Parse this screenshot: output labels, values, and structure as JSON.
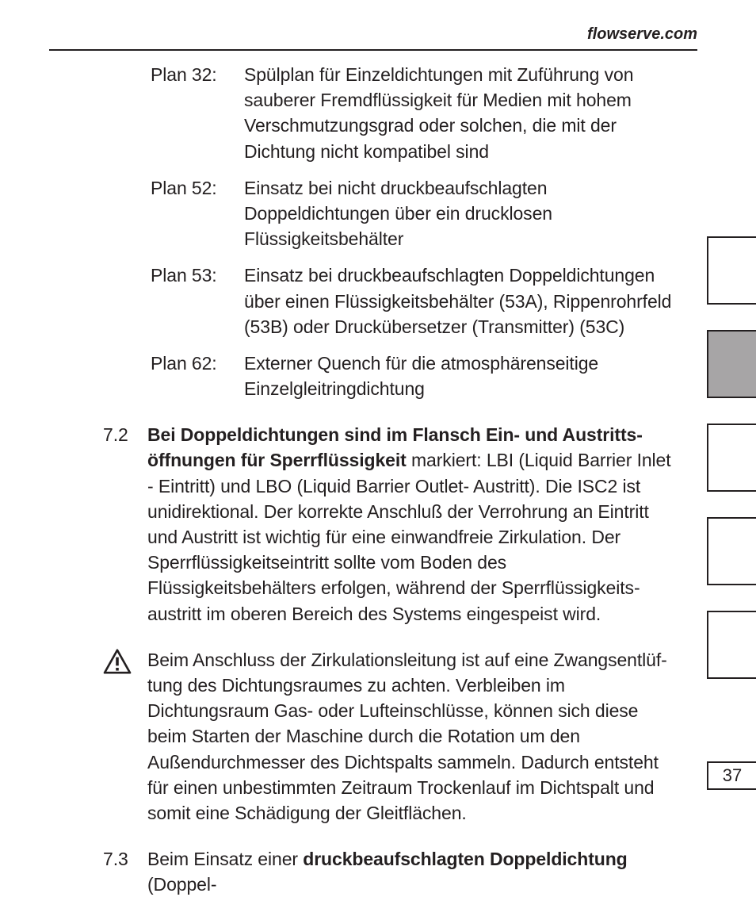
{
  "header": {
    "site": "flowserve.com"
  },
  "plans": [
    {
      "label": "Plan 32:",
      "text": "Spülplan für Einzeldichtungen mit Zuführung von sauberer Fremdflüssigkeit für Medien mit hohem Verschmutzungsgrad oder solchen, die mit der Dichtung nicht kompatibel sind"
    },
    {
      "label": "Plan 52:",
      "text": "Einsatz bei nicht druckbeaufschlagten Doppeldichtungen über ein drucklosen Flüssigkeitsbehälter"
    },
    {
      "label": "Plan 53:",
      "text": "Einsatz bei druckbeaufschlagten Doppeldichtungen über einen Flüssigkeitsbehälter (53A), Rippenrohrfeld (53B) oder Druckübersetzer (Transmitter) (53C)"
    },
    {
      "label": "Plan 62:",
      "text": "Externer Quench für die atmosphärenseitige Einzelgleitringdichtung"
    }
  ],
  "sections": {
    "s72_num": "7.2",
    "s72_bold": "Bei Doppeldichtungen sind im Flansch Ein- und Austritts­öffnungen für Sperrflüssigkeit",
    "s72_rest": " markiert: LBI (Liquid Barrier Inlet - Eintritt) und LBO (Liquid Barrier Outlet- Austritt). Die ISC2 ist unidirektional. Der korrekte Anschluß der Verrohrung an Eintritt und Austritt ist wichtig für eine einwandfreie Zirkulation. Der Sperrflüssigkeitseintritt sollte vom Boden des Flüssigkeitsbehälters erfolgen, während der Sperrflüssigkeits­austritt im oberen Bereich des Systems eingespeist wird.",
    "warn": "Beim Anschluss der Zirkulationsleitung ist auf eine Zwangsentlüf­tung des Dichtungsraumes zu achten. Verbleiben im Dichtungsraum Gas- oder Lufteinschlüsse, können sich diese beim Starten der Maschine durch die Rotation um den Außendurchmesser des Dichtspalts sammeln. Dadurch entsteht für einen unbestimmten Zeitraum Trockenlauf im Dichtspalt und somit eine Schädigung der Gleitflächen.",
    "s73_num": "7.3",
    "s73_pre": "Beim Einsatz einer ",
    "s73_bold": "druckbeaufschlagten Doppeldichtung",
    "s73_post": " (Doppel-"
  },
  "page_number": "37"
}
